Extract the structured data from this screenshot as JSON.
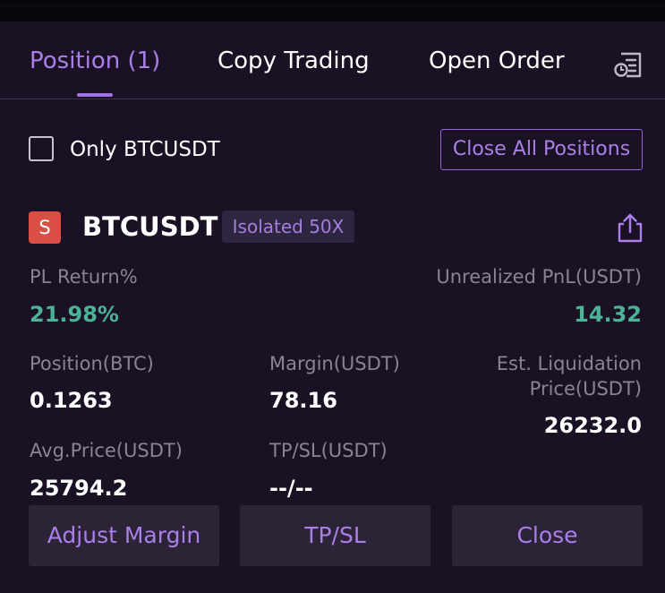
{
  "tabs": [
    {
      "label": "Position (1)",
      "active": true
    },
    {
      "label": "Copy Trading",
      "active": false
    },
    {
      "label": "Open Order",
      "active": false
    }
  ],
  "filter": {
    "checkbox_label": "Only BTCUSDT",
    "checked": false
  },
  "close_all_label": "Close All Positions",
  "position": {
    "side_badge": "S",
    "symbol": "BTCUSDT",
    "leverage_tag": "Isolated 50X",
    "pl_return_label": "PL Return%",
    "pl_return_value": "21.98%",
    "unrealized_pnl_label": "Unrealized PnL(USDT)",
    "unrealized_pnl_value": "14.32",
    "position_size_label": "Position(BTC)",
    "position_size_value": "0.1263",
    "margin_label": "Margin(USDT)",
    "margin_value": "78.16",
    "liq_price_label_line1": "Est. Liquidation",
    "liq_price_label_line2": "Price(USDT)",
    "liq_price_value": "26232.0",
    "avg_price_label": "Avg.Price(USDT)",
    "avg_price_value": "25794.2",
    "tpsl_label": "TP/SL(USDT)",
    "tpsl_value": "--/--"
  },
  "actions": {
    "adjust_margin": "Adjust Margin",
    "tpsl": "TP/SL",
    "close": "Close"
  },
  "colors": {
    "background": "#1a1125",
    "accent": "#a980e8",
    "profit": "#4cb398",
    "short_badge": "#db4e45"
  },
  "icons": {
    "tabs_right": "order-history-icon",
    "share": "share-icon"
  }
}
